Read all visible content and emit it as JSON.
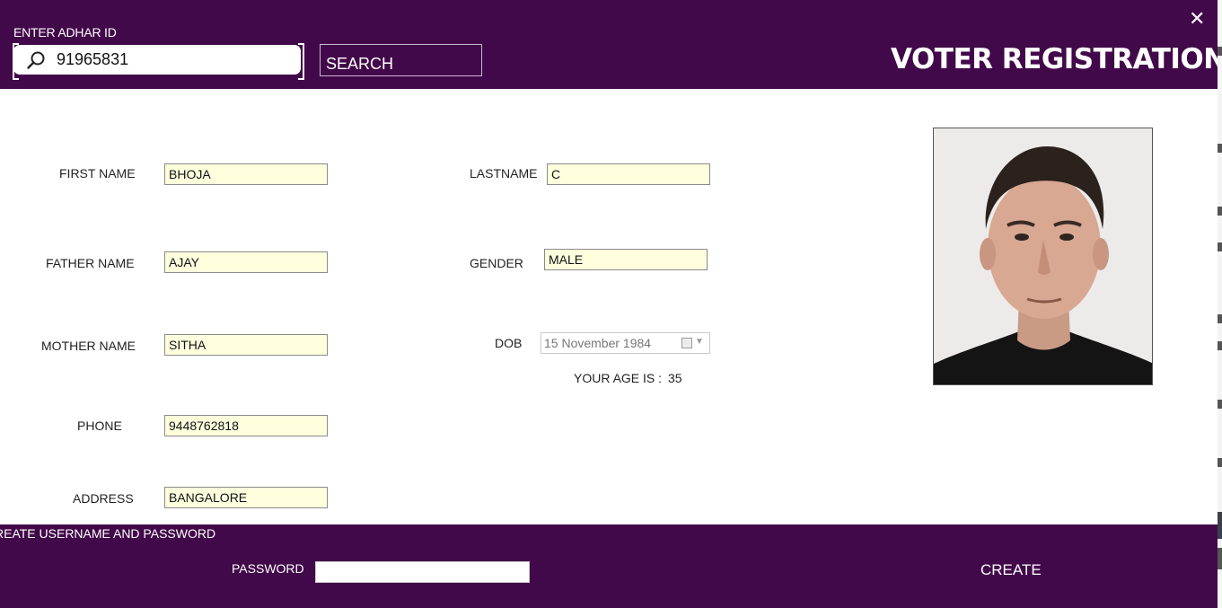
{
  "header": {
    "adhar_label": "ENTER ADHAR ID",
    "adhar_value": "91965831",
    "search_button": "SEARCH",
    "close_label": "✕",
    "title": "VOTER REGISTRATION"
  },
  "form": {
    "first_name": {
      "label": "FIRST NAME",
      "value": "BHOJA"
    },
    "last_name": {
      "label": "LASTNAME",
      "value": "C"
    },
    "father_name": {
      "label": "FATHER NAME",
      "value": "AJAY"
    },
    "gender": {
      "label": "GENDER",
      "value": "MALE"
    },
    "mother_name": {
      "label": "MOTHER NAME",
      "value": "SITHA"
    },
    "dob": {
      "label": "DOB",
      "value": "15 November 1984"
    },
    "age": {
      "label": "YOUR AGE IS :",
      "value": "35"
    },
    "phone": {
      "label": "PHONE",
      "value": "9448762818"
    },
    "address": {
      "label": "ADDRESS",
      "value": "BANGALORE"
    }
  },
  "footer": {
    "section_label": "REATE USERNAME AND PASSWORD",
    "password_label": "PASSWORD",
    "password_value": "",
    "create_button": "CREATE"
  },
  "colors": {
    "brand": "#42094a",
    "field_bg": "#ffffde"
  },
  "icons": {
    "search": "search-icon",
    "close": "close-icon",
    "calendar": "calendar-icon"
  }
}
